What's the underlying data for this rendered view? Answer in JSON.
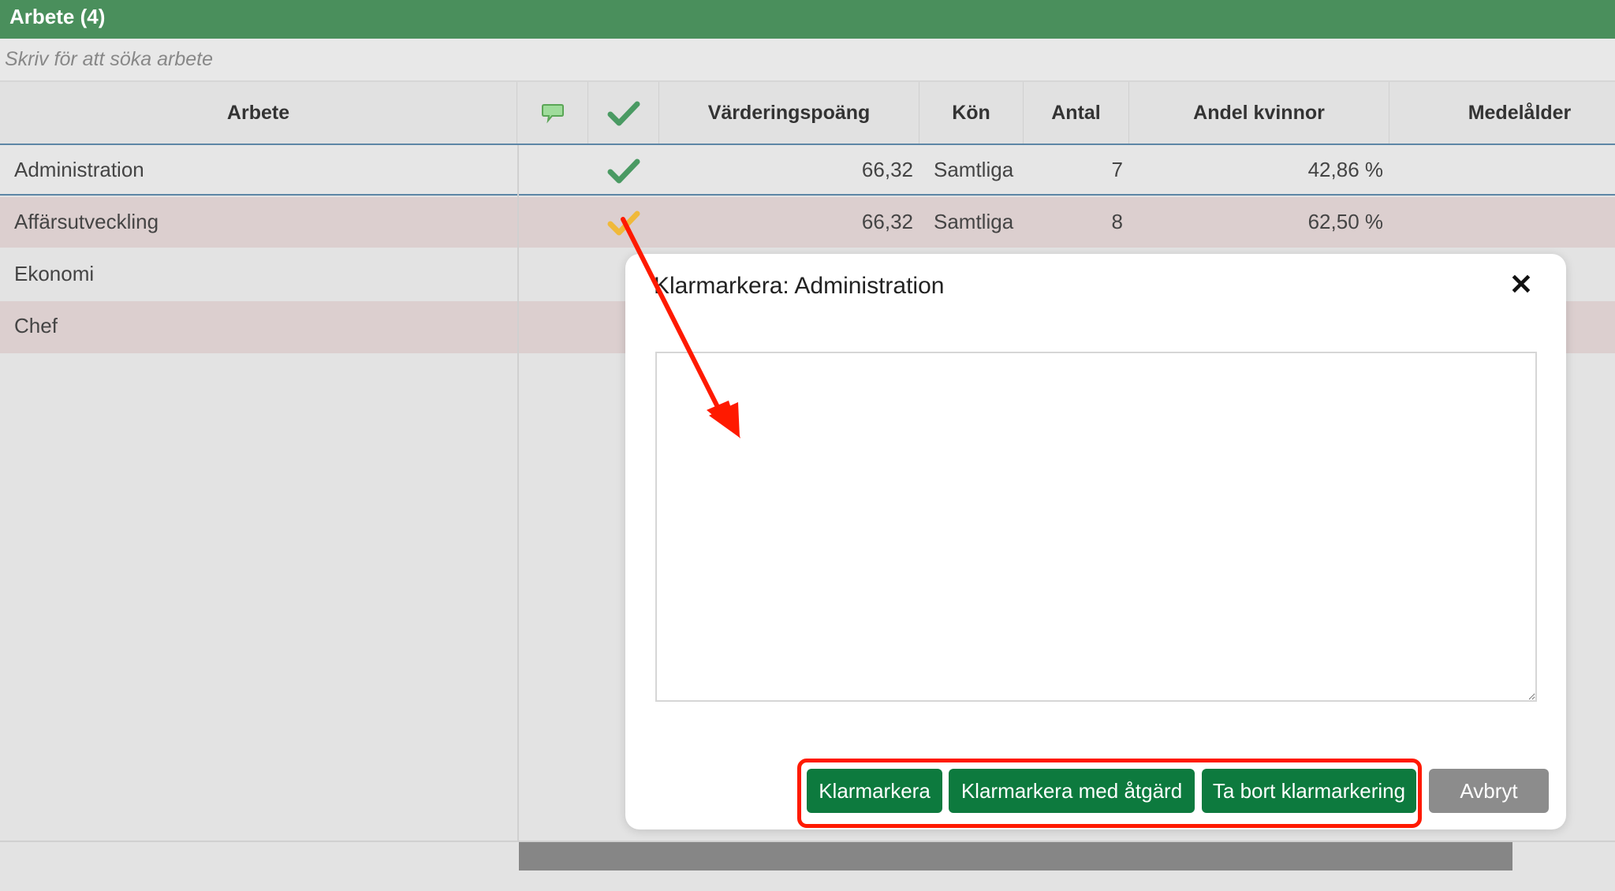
{
  "header": {
    "title": "Arbete (4)"
  },
  "search": {
    "placeholder": "Skriv för att söka arbete"
  },
  "columns": {
    "arbete": "Arbete",
    "comment_icon": "speech-bubble-icon",
    "status_icon": "checkmark-icon",
    "varderingspoang": "Värderingspoäng",
    "kon": "Kön",
    "antal": "Antal",
    "andel_kvinnor": "Andel kvinnor",
    "medelalder": "Medelålder"
  },
  "rows": [
    {
      "arbete": "Administration",
      "status": "done",
      "varderingspoang": "66,32",
      "kon": "Samtliga",
      "antal": "7",
      "andel_kvinnor": "42,86 %"
    },
    {
      "arbete": "Affärsutveckling",
      "status": "action",
      "varderingspoang": "66,32",
      "kon": "Samtliga",
      "antal": "8",
      "andel_kvinnor": "62,50 %"
    },
    {
      "arbete": "Ekonomi"
    },
    {
      "arbete": "Chef"
    }
  ],
  "modal": {
    "title": "Klarmarkera: Administration",
    "close_icon": "close-icon",
    "comment_value": "",
    "buttons": {
      "klarmarkera": "Klarmarkera",
      "klarmarkera_med_atgard": "Klarmarkera med åtgärd",
      "ta_bort": "Ta bort klarmarkering",
      "avbryt": "Avbryt"
    }
  },
  "colors": {
    "header_green": "#4a8f5c",
    "check_green": "#4a9a63",
    "check_yellow": "#f0b93a",
    "button_green": "#0d7a3e",
    "annotation_red": "#ff1a00"
  }
}
